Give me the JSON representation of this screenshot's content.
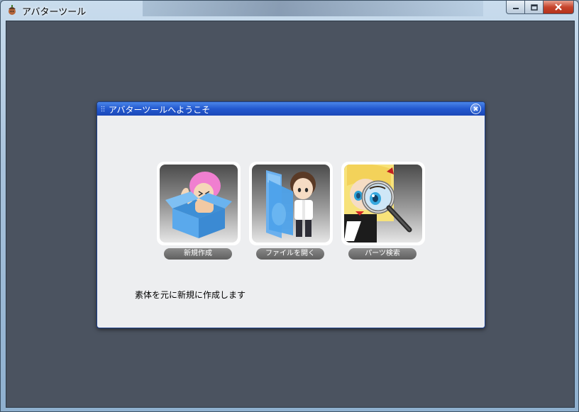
{
  "window": {
    "title": "アバターツール",
    "icon": "acorn-app-icon"
  },
  "dialog": {
    "title": "アバターツールへようこそ",
    "cards": [
      {
        "label": "新規作成",
        "icon": "new-avatar-box-icon"
      },
      {
        "label": "ファイルを開く",
        "icon": "open-folder-icon"
      },
      {
        "label": "パーツ検索",
        "icon": "magnifier-search-icon"
      }
    ],
    "description": "素体を元に新規に作成します"
  },
  "colors": {
    "client_bg": "#4b5360",
    "dialog_bg": "#edeef0",
    "dialog_title_bar": "#2358cf",
    "label_pill": "#6e6e6e"
  }
}
